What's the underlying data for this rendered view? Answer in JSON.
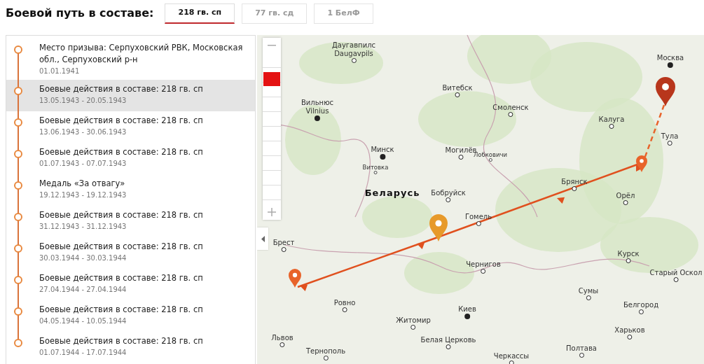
{
  "header": {
    "title": "Боевой путь в составе:"
  },
  "tabs": [
    {
      "label": "218 гв. сп",
      "selected": true
    },
    {
      "label": "77 гв. сд",
      "selected": false
    },
    {
      "label": "1 БелФ",
      "selected": false
    }
  ],
  "timeline": [
    {
      "title": "Место призыва: Серпуховский РВК, Московская обл., Серпуховский р-н",
      "date": "01.01.1941",
      "selected": false
    },
    {
      "title": "Боевые действия в составе: 218 гв. сп",
      "date": "13.05.1943 - 20.05.1943",
      "selected": true
    },
    {
      "title": "Боевые действия в составе: 218 гв. сп",
      "date": "13.06.1943 - 30.06.1943",
      "selected": false
    },
    {
      "title": "Боевые действия в составе: 218 гв. сп",
      "date": "01.07.1943 - 07.07.1943",
      "selected": false
    },
    {
      "title": "Медаль «За отвагу»",
      "date": "19.12.1943 - 19.12.1943",
      "selected": false
    },
    {
      "title": "Боевые действия в составе: 218 гв. сп",
      "date": "31.12.1943 - 31.12.1943",
      "selected": false
    },
    {
      "title": "Боевые действия в составе: 218 гв. сп",
      "date": "30.03.1944 - 30.03.1944",
      "selected": false
    },
    {
      "title": "Боевые действия в составе: 218 гв. сп",
      "date": "27.04.1944 - 27.04.1944",
      "selected": false
    },
    {
      "title": "Боевые действия в составе: 218 гв. сп",
      "date": "04.05.1944 - 10.05.1944",
      "selected": false
    },
    {
      "title": "Боевые действия в составе: 218 гв. сп",
      "date": "01.07.1944 - 17.07.1944",
      "selected": false
    }
  ],
  "map": {
    "zoom": {
      "level": 0.86
    },
    "places": [
      {
        "kind": "city",
        "label": "Даугавпилс",
        "label_latin": "Daugavpils"
      },
      {
        "kind": "capital",
        "label": "Москва"
      },
      {
        "kind": "city",
        "label": "Витебск"
      },
      {
        "kind": "capital",
        "label": "Вильнюс",
        "label_latin": "Vilnius"
      },
      {
        "kind": "city",
        "label": "Смоленск"
      },
      {
        "kind": "city",
        "label": "Калуга"
      },
      {
        "kind": "city",
        "label": "Тула"
      },
      {
        "kind": "capital",
        "label": "Минск"
      },
      {
        "kind": "city",
        "label": "Могилёв"
      },
      {
        "kind": "town",
        "label": "Лобковичи"
      },
      {
        "kind": "town",
        "label": "Витовка"
      },
      {
        "kind": "city",
        "label": "Брянск"
      },
      {
        "kind": "country",
        "label": "Беларусь"
      },
      {
        "kind": "city",
        "label": "Бобруйск"
      },
      {
        "kind": "city",
        "label": "Орёл"
      },
      {
        "kind": "city",
        "label": "Гомель"
      },
      {
        "kind": "city",
        "label": "Брест"
      },
      {
        "kind": "city",
        "label": "Курск"
      },
      {
        "kind": "city",
        "label": "Чернигов"
      },
      {
        "kind": "city",
        "label": "Старый Оскол"
      },
      {
        "kind": "city",
        "label": "Сумы"
      },
      {
        "kind": "city",
        "label": "Ровно"
      },
      {
        "kind": "city",
        "label": "Белгород"
      },
      {
        "kind": "capital",
        "label": "Киев"
      },
      {
        "kind": "city",
        "label": "Житомир"
      },
      {
        "kind": "city",
        "label": "Харьков"
      },
      {
        "kind": "city",
        "label": "Львов"
      },
      {
        "kind": "city",
        "label": "Белая Церковь"
      },
      {
        "kind": "city",
        "label": "Полтава"
      },
      {
        "kind": "city",
        "label": "Тернополь"
      },
      {
        "kind": "city",
        "label": "Черкассы"
      }
    ]
  }
}
